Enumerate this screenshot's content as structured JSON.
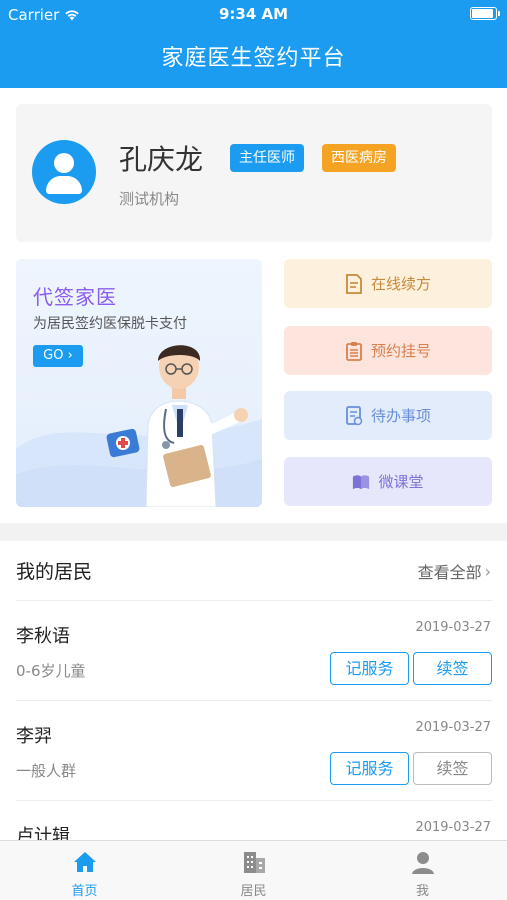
{
  "status_bar": {
    "carrier": "Carrier",
    "time": "9:34 AM"
  },
  "header": {
    "title": "家庭医生签约平台"
  },
  "profile": {
    "name": "孔庆龙",
    "organization": "测试机构",
    "badges": [
      {
        "label": "主任医师",
        "color": "#1b9cf0"
      },
      {
        "label": "西医病房",
        "color": "#f5a323"
      }
    ]
  },
  "promo": {
    "title": "代签家医",
    "subtitle": "为居民签约医保脱卡支付",
    "go_label": "GO"
  },
  "quick_actions": [
    {
      "label": "在线续方",
      "icon": "prescription-icon",
      "color": "#c88a3c"
    },
    {
      "label": "预约挂号",
      "icon": "clipboard-icon",
      "color": "#d9804f"
    },
    {
      "label": "待办事项",
      "icon": "todo-icon",
      "color": "#6a8fd8"
    },
    {
      "label": "微课堂",
      "icon": "book-icon",
      "color": "#7c72d6"
    }
  ],
  "residents_section": {
    "title": "我的居民",
    "see_all": "查看全部",
    "items": [
      {
        "name": "李秋语",
        "date": "2019-03-27",
        "group": "0-6岁儿童",
        "service_label": "记服务",
        "renew_label": "续签"
      },
      {
        "name": "李羿",
        "date": "2019-03-27",
        "group": "一般人群",
        "service_label": "记服务",
        "renew_label": "续签"
      },
      {
        "name": "卢计辑",
        "date": "2019-03-27",
        "group": "",
        "service_label": "",
        "renew_label": ""
      }
    ]
  },
  "tab_bar": {
    "tabs": [
      {
        "label": "首页",
        "icon": "home-icon",
        "active": true
      },
      {
        "label": "居民",
        "icon": "building-icon",
        "active": false
      },
      {
        "label": "我",
        "icon": "person-icon",
        "active": false
      }
    ]
  },
  "colors": {
    "primary": "#1b9cf0",
    "accent_orange": "#f5a323",
    "promo_title": "#8a5cf0"
  }
}
